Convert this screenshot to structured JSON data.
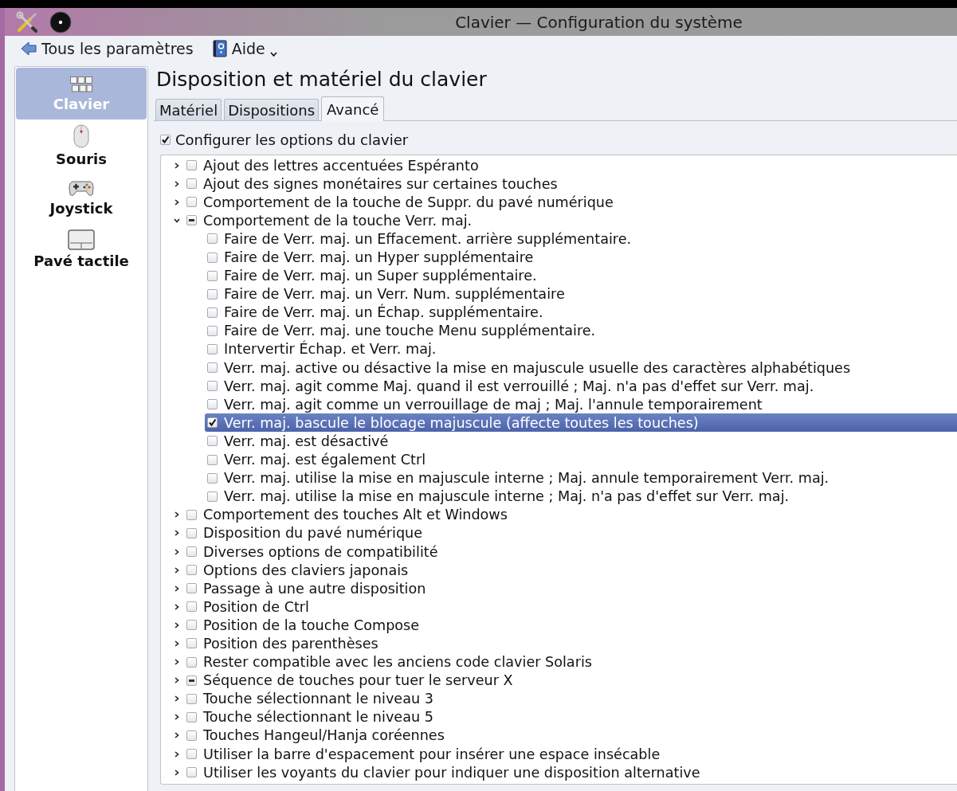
{
  "window": {
    "title": "Clavier — Configuration du système"
  },
  "toolbar": {
    "back_label": "Tous les paramètres",
    "help_label": "Aide"
  },
  "sidebar": {
    "items": [
      {
        "label": "Clavier",
        "kind": "keyboard",
        "selected": true
      },
      {
        "label": "Souris",
        "kind": "mouse",
        "selected": false
      },
      {
        "label": "Joystick",
        "kind": "gamepad",
        "selected": false
      },
      {
        "label": "Pavé tactile",
        "kind": "touchpad",
        "selected": false
      }
    ]
  },
  "page_title": "Disposition et matériel du clavier",
  "tabs": [
    {
      "label": "Matériel",
      "selected": false
    },
    {
      "label": "Dispositions",
      "selected": false
    },
    {
      "label": "Avancé",
      "selected": true
    }
  ],
  "configure_option": {
    "label": "Configurer les options du clavier",
    "checked": true
  },
  "options": [
    {
      "label": "Ajout des lettres accentuées Espéranto",
      "expanded": false,
      "checked": false,
      "partial": false,
      "selected": false
    },
    {
      "label": "Ajout des signes monétaires sur certaines touches",
      "expanded": false,
      "checked": false,
      "partial": false,
      "selected": false
    },
    {
      "label": "Comportement de la touche de Suppr. du pavé numérique",
      "expanded": false,
      "checked": false,
      "partial": false,
      "selected": false
    },
    {
      "label": "Comportement de la touche Verr. maj.",
      "expanded": true,
      "checked": false,
      "partial": true,
      "selected": false,
      "children": [
        {
          "label": "Faire de Verr. maj. un Effacement. arrière supplémentaire.",
          "checked": false,
          "selected": false
        },
        {
          "label": "Faire de Verr. maj. un Hyper supplémentaire",
          "checked": false,
          "selected": false
        },
        {
          "label": "Faire de Verr. maj. un Super supplémentaire.",
          "checked": false,
          "selected": false
        },
        {
          "label": "Faire de Verr. maj. un Verr. Num. supplémentaire",
          "checked": false,
          "selected": false
        },
        {
          "label": "Faire de Verr. maj. un Échap. supplémentaire.",
          "checked": false,
          "selected": false
        },
        {
          "label": "Faire de Verr. maj. une touche Menu supplémentaire.",
          "checked": false,
          "selected": false
        },
        {
          "label": "Intervertir Échap. et Verr. maj.",
          "checked": false,
          "selected": false
        },
        {
          "label": "Verr. maj. active ou désactive la mise en majuscule usuelle des caractères alphabétiques",
          "checked": false,
          "selected": false
        },
        {
          "label": "Verr. maj. agit comme Maj. quand il est verrouillé ; Maj. n'a pas d'effet sur Verr. maj.",
          "checked": false,
          "selected": false
        },
        {
          "label": "Verr. maj. agit comme un verrouillage de maj ; Maj. l'annule temporairement",
          "checked": false,
          "selected": false
        },
        {
          "label": "Verr. maj. bascule le blocage majuscule (affecte toutes les touches)",
          "checked": true,
          "selected": true
        },
        {
          "label": "Verr. maj. est désactivé",
          "checked": false,
          "selected": false
        },
        {
          "label": "Verr. maj. est également Ctrl",
          "checked": false,
          "selected": false
        },
        {
          "label": "Verr. maj. utilise la mise en majuscule interne ; Maj. annule temporairement Verr. maj.",
          "checked": false,
          "selected": false
        },
        {
          "label": "Verr. maj. utilise la mise en majuscule interne ; Maj. n'a pas d'effet sur Verr. maj.",
          "checked": false,
          "selected": false
        }
      ]
    },
    {
      "label": "Comportement des touches Alt et Windows",
      "expanded": false,
      "checked": false,
      "partial": false,
      "selected": false
    },
    {
      "label": "Disposition du pavé numérique",
      "expanded": false,
      "checked": false,
      "partial": false,
      "selected": false
    },
    {
      "label": "Diverses options de compatibilité",
      "expanded": false,
      "checked": false,
      "partial": false,
      "selected": false
    },
    {
      "label": "Options des claviers japonais",
      "expanded": false,
      "checked": false,
      "partial": false,
      "selected": false
    },
    {
      "label": "Passage à une autre disposition",
      "expanded": false,
      "checked": false,
      "partial": false,
      "selected": false
    },
    {
      "label": "Position de Ctrl",
      "expanded": false,
      "checked": false,
      "partial": false,
      "selected": false
    },
    {
      "label": "Position de la touche Compose",
      "expanded": false,
      "checked": false,
      "partial": false,
      "selected": false
    },
    {
      "label": "Position des parenthèses",
      "expanded": false,
      "checked": false,
      "partial": false,
      "selected": false
    },
    {
      "label": "Rester compatible avec les anciens code clavier Solaris",
      "expanded": false,
      "checked": false,
      "partial": false,
      "selected": false
    },
    {
      "label": "Séquence de touches pour tuer le serveur X",
      "expanded": false,
      "checked": false,
      "partial": true,
      "selected": false
    },
    {
      "label": "Touche sélectionnant le niveau 3",
      "expanded": false,
      "checked": false,
      "partial": false,
      "selected": false
    },
    {
      "label": "Touche sélectionnant le niveau 5",
      "expanded": false,
      "checked": false,
      "partial": false,
      "selected": false
    },
    {
      "label": "Touches Hangeul/Hanja coréennes",
      "expanded": false,
      "checked": false,
      "partial": false,
      "selected": false
    },
    {
      "label": "Utiliser la barre d'espacement pour insérer une espace insécable",
      "expanded": false,
      "checked": false,
      "partial": false,
      "selected": false
    },
    {
      "label": "Utiliser les voyants du clavier pour indiquer une disposition alternative",
      "expanded": false,
      "checked": false,
      "partial": false,
      "selected": false
    }
  ]
}
